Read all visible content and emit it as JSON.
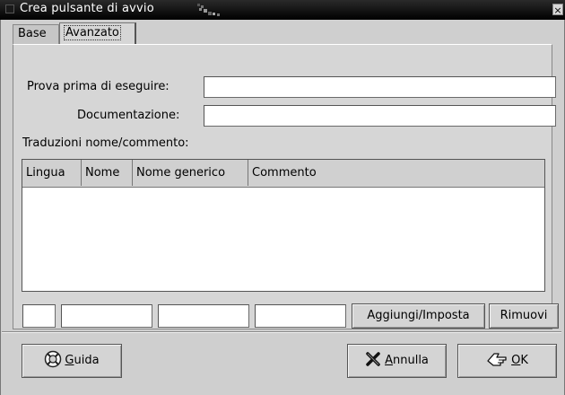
{
  "window": {
    "title": "Crea pulsante di avvio",
    "close_glyph": "×"
  },
  "tabs": [
    {
      "label": "Base",
      "selected": false
    },
    {
      "label": "Avanzato",
      "selected": true
    }
  ],
  "form": {
    "try_exec_label": "Prova prima di eseguire:",
    "try_exec_value": "",
    "doc_label": "Documentazione:",
    "doc_value": ""
  },
  "translations": {
    "section_label": "Traduzioni nome/commento:",
    "columns": [
      "Lingua",
      "Nome",
      "Nome generico",
      "Commento"
    ],
    "rows": [],
    "entries": [
      "",
      "",
      "",
      ""
    ],
    "add_button": "Aggiungi/Imposta",
    "remove_button": "Rimuovi"
  },
  "actions": {
    "help": {
      "mnemonic": "G",
      "rest": "uida",
      "icon": "lifebuoy-icon"
    },
    "cancel": {
      "mnemonic": "A",
      "rest": "nnulla",
      "icon": "cross-icon"
    },
    "ok": {
      "mnemonic": "O",
      "rest": "K",
      "icon": "checkmark-hand-icon"
    }
  }
}
